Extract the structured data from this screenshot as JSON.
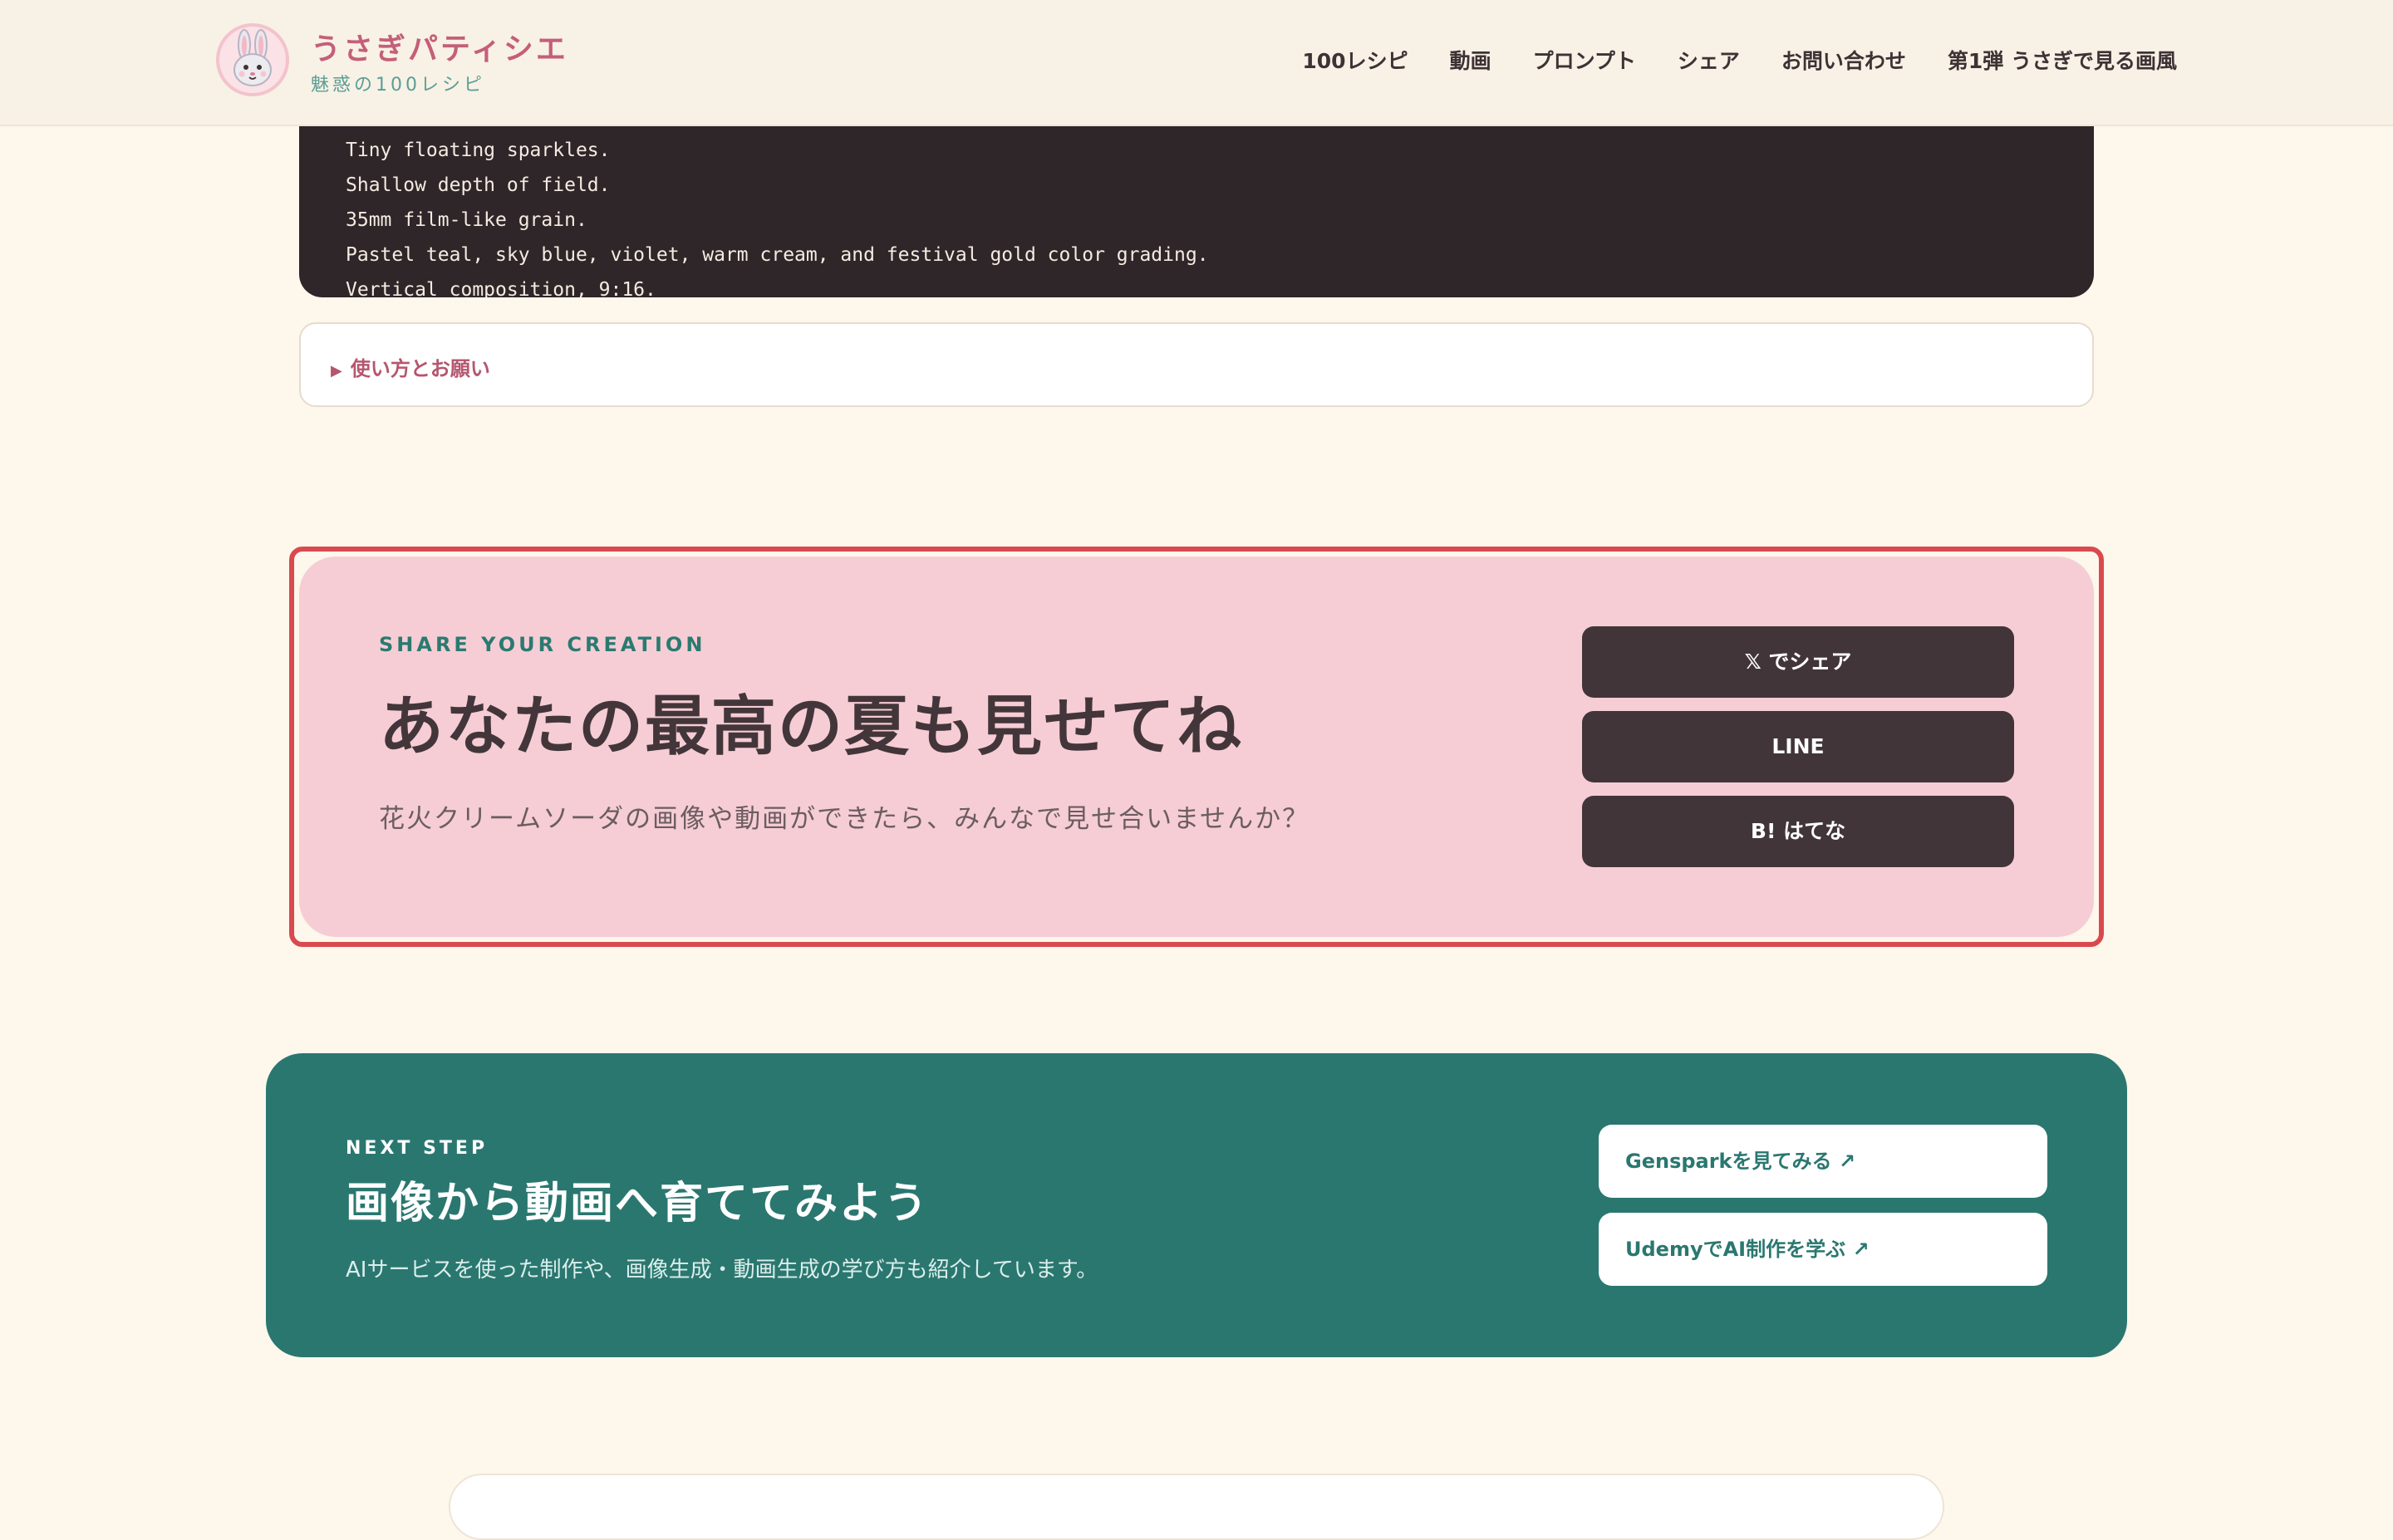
{
  "header": {
    "brand_title": "うさぎパティシエ",
    "brand_subtitle": "魅惑の100レシピ",
    "nav": [
      "100レシピ",
      "動画",
      "プロンプト",
      "シェア",
      "お問い合わせ",
      "第1弾 うさぎで見る画風"
    ]
  },
  "code_block": {
    "lines": [
      "Tiny floating sparkles.",
      "Shallow depth of field.",
      "35mm film-like grain.",
      "Pastel teal, sky blue, violet, warm cream, and festival gold color grading.",
      "Vertical composition, 9:16."
    ]
  },
  "details": {
    "toggle_icon": "▶",
    "label": "使い方とお願い"
  },
  "share": {
    "eyebrow": "SHARE YOUR CREATION",
    "heading": "あなたの最高の夏も見せてね",
    "description": "花火クリームソーダの画像や動画ができたら、みんなで見せ合いませんか？",
    "buttons": [
      "𝕏 でシェア",
      "LINE",
      "B! はてな"
    ]
  },
  "next_step": {
    "eyebrow": "NEXT STEP",
    "heading": "画像から動画へ育ててみよう",
    "description": "AIサービスを使った制作や、画像生成・動画生成の学び方も紹介しています。",
    "buttons": [
      "Gensparkを見てみる ↗",
      "UdemyでAI制作を学ぶ ↗"
    ]
  },
  "colors": {
    "background": "#fdf7ec",
    "brand_pink": "#c45f79",
    "share_card": "#f6cdd5",
    "dark_button": "#41353a",
    "teal": "#2a7770",
    "highlight_outline": "#d94a4f"
  },
  "icons": {
    "logo": "rabbit-face-icon",
    "toggle": "triangle-right-icon",
    "external": "external-link-icon"
  }
}
